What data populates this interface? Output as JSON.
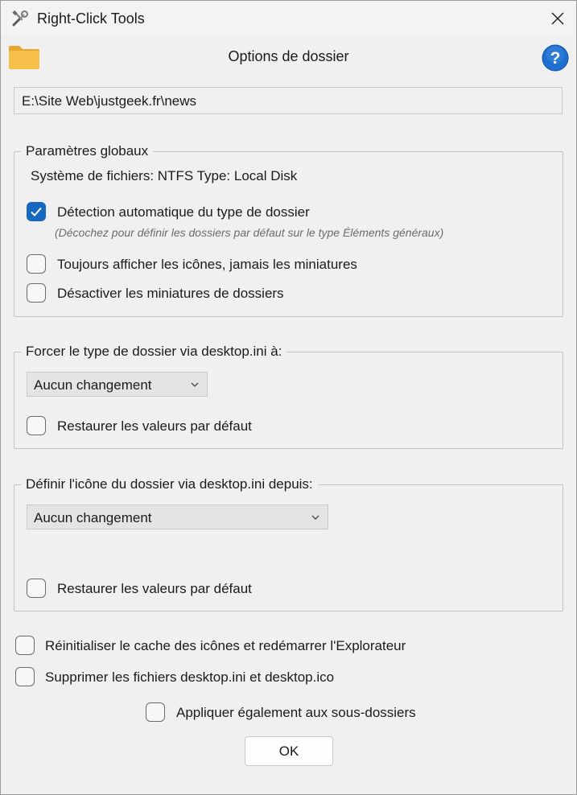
{
  "window": {
    "title": "Right-Click Tools"
  },
  "dialog": {
    "title": "Options de dossier",
    "path": "E:\\Site Web\\justgeek.fr\\news"
  },
  "global_group": {
    "legend": "Paramètres globaux",
    "filesystem_label": "Système de fichiers: NTFS  Type: Local Disk",
    "auto_detect": {
      "label": "Détection automatique du type de dossier",
      "checked": true
    },
    "auto_detect_hint": "(Décochez pour définir les dossiers par défaut sur le type Éléments généraux)",
    "always_icons": {
      "label": "Toujours afficher les icônes, jamais les miniatures",
      "checked": false
    },
    "disable_thumbnails": {
      "label": "Désactiver les miniatures de dossiers",
      "checked": false
    }
  },
  "force_type_group": {
    "legend": "Forcer le type de dossier via desktop.ini à:",
    "combo_value": "Aucun changement",
    "restore": {
      "label": "Restaurer les valeurs par défaut",
      "checked": false
    }
  },
  "icon_group": {
    "legend": "Définir l'icône du dossier via desktop.ini depuis:",
    "combo_value": "Aucun changement",
    "restore": {
      "label": "Restaurer les valeurs par défaut",
      "checked": false
    }
  },
  "reset_cache": {
    "label": "Réinitialiser le cache des icônes et redémarrer l'Explorateur",
    "checked": false
  },
  "delete_files": {
    "label": "Supprimer les fichiers desktop.ini et desktop.ico",
    "checked": false
  },
  "apply_sub": {
    "label": "Appliquer également aux sous-dossiers",
    "checked": false
  },
  "buttons": {
    "ok": "OK"
  },
  "icons": {
    "app": "tools-icon",
    "close": "close-icon",
    "folder": "folder-icon",
    "help": "help-icon",
    "check": "checkmark-icon",
    "chevron": "chevron-down-icon"
  },
  "colors": {
    "accent": "#1667bf",
    "help": "#1f6fd1",
    "folder": "#f4b73f"
  }
}
